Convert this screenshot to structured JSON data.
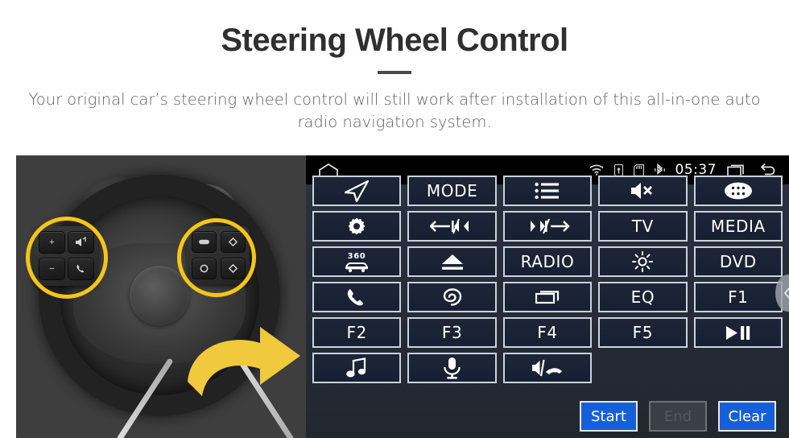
{
  "header": {
    "title": "Steering Wheel Control",
    "subtitle": "Your original car’s steering wheel control will still work after installation of this all-in-one auto radio navigation system."
  },
  "photo": {
    "alt_name": "steering-wheel-photo",
    "highlight_color": "#f5c518",
    "arrow_color": "#f0c93c",
    "left_pad_keys": [
      "+",
      "−",
      "volume-source-icon",
      "phone-icon"
    ],
    "right_pad_keys": [
      "cruise-icon",
      "diamond-up-icon",
      "circle-icon",
      "diamond-down-icon"
    ]
  },
  "unit": {
    "statusbar": {
      "home_icon": "home-icon",
      "icons": [
        "wifi-icon",
        "usb-lock-icon",
        "sdcard-icon",
        "bluetooth-icon"
      ],
      "time": "05:37",
      "recent_icon": "recent-apps-icon",
      "back_icon": "back-icon"
    },
    "buttons": [
      {
        "label": "",
        "icon": "navigation-arrow-icon",
        "name": "navigation"
      },
      {
        "label": "MODE",
        "icon": "",
        "name": "mode"
      },
      {
        "label": "",
        "icon": "list-icon",
        "name": "list"
      },
      {
        "label": "",
        "icon": "mute-icon",
        "name": "mute"
      },
      {
        "label": "",
        "icon": "apps-grid-icon",
        "name": "apps"
      },
      {
        "label": "",
        "icon": "power-gear-icon",
        "name": "power"
      },
      {
        "label": "",
        "icon": "previous-track-icon",
        "name": "previous"
      },
      {
        "label": "",
        "icon": "next-track-icon",
        "name": "next"
      },
      {
        "label": "TV",
        "icon": "",
        "name": "tv"
      },
      {
        "label": "MEDIA",
        "icon": "",
        "name": "media"
      },
      {
        "label": "",
        "icon": "360-camera-icon",
        "name": "camera-360"
      },
      {
        "label": "",
        "icon": "eject-icon",
        "name": "eject"
      },
      {
        "label": "RADIO",
        "icon": "",
        "name": "radio"
      },
      {
        "label": "",
        "icon": "brightness-icon",
        "name": "brightness"
      },
      {
        "label": "DVD",
        "icon": "",
        "name": "dvd"
      },
      {
        "label": "",
        "icon": "phone-icon",
        "name": "phone"
      },
      {
        "label": "",
        "icon": "swirl-icon",
        "name": "swirl"
      },
      {
        "label": "",
        "icon": "window-icon",
        "name": "window"
      },
      {
        "label": "EQ",
        "icon": "",
        "name": "eq"
      },
      {
        "label": "F1",
        "icon": "",
        "name": "f1"
      },
      {
        "label": "F2",
        "icon": "",
        "name": "f2"
      },
      {
        "label": "F3",
        "icon": "",
        "name": "f3"
      },
      {
        "label": "F4",
        "icon": "",
        "name": "f4"
      },
      {
        "label": "F5",
        "icon": "",
        "name": "f5"
      },
      {
        "label": "",
        "icon": "play-pause-icon",
        "name": "play-pause"
      },
      {
        "label": "",
        "icon": "music-note-icon",
        "name": "music"
      },
      {
        "label": "",
        "icon": "microphone-icon",
        "name": "microphone"
      },
      {
        "label": "",
        "icon": "speaker-hangup-icon",
        "name": "speaker-hangup"
      },
      {
        "label": "",
        "icon": "",
        "name": "empty-1"
      },
      {
        "label": "",
        "icon": "",
        "name": "empty-2"
      }
    ],
    "footer": {
      "start": "Start",
      "end": "End",
      "clear": "Clear",
      "end_disabled": true,
      "accent_color": "#1560d8"
    },
    "side_tab_icon": "chevron-left-icon"
  }
}
